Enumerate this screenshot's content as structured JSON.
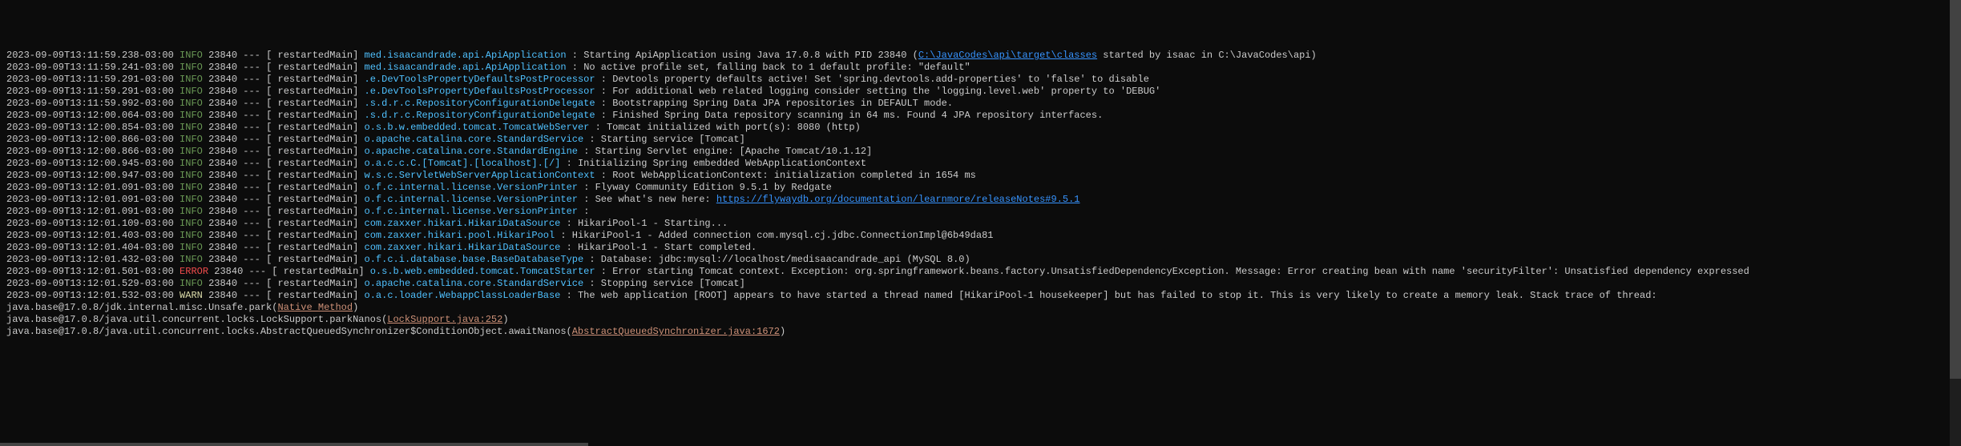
{
  "logs": [
    {
      "ts": "2023-09-09T13:11:59.238-03:00",
      "level": "INFO",
      "pid": "23840",
      "thread": "restartedMain",
      "logger": "med.isaacandrade.api.ApiApplication",
      "msg_pre": "Starting ApiApplication using Java 17.0.8 with PID 23840 (",
      "link": "C:\\JavaCodes\\api\\target\\classes",
      "msg_post": " started by isaac in C:\\JavaCodes\\api)"
    },
    {
      "ts": "2023-09-09T13:11:59.241-03:00",
      "level": "INFO",
      "pid": "23840",
      "thread": "restartedMain",
      "logger": "med.isaacandrade.api.ApiApplication",
      "msg": "No active profile set, falling back to 1 default profile: \"default\""
    },
    {
      "ts": "2023-09-09T13:11:59.291-03:00",
      "level": "INFO",
      "pid": "23840",
      "thread": "restartedMain",
      "logger": ".e.DevToolsPropertyDefaultsPostProcessor",
      "msg": "Devtools property defaults active! Set 'spring.devtools.add-properties' to 'false' to disable"
    },
    {
      "ts": "2023-09-09T13:11:59.291-03:00",
      "level": "INFO",
      "pid": "23840",
      "thread": "restartedMain",
      "logger": ".e.DevToolsPropertyDefaultsPostProcessor",
      "msg": "For additional web related logging consider setting the 'logging.level.web' property to 'DEBUG'"
    },
    {
      "ts": "2023-09-09T13:11:59.992-03:00",
      "level": "INFO",
      "pid": "23840",
      "thread": "restartedMain",
      "logger": ".s.d.r.c.RepositoryConfigurationDelegate",
      "msg": "Bootstrapping Spring Data JPA repositories in DEFAULT mode."
    },
    {
      "ts": "2023-09-09T13:12:00.064-03:00",
      "level": "INFO",
      "pid": "23840",
      "thread": "restartedMain",
      "logger": ".s.d.r.c.RepositoryConfigurationDelegate",
      "msg": "Finished Spring Data repository scanning in 64 ms. Found 4 JPA repository interfaces."
    },
    {
      "ts": "2023-09-09T13:12:00.854-03:00",
      "level": "INFO",
      "pid": "23840",
      "thread": "restartedMain",
      "logger": "o.s.b.w.embedded.tomcat.TomcatWebServer",
      "msg": "Tomcat initialized with port(s): 8080 (http)"
    },
    {
      "ts": "2023-09-09T13:12:00.866-03:00",
      "level": "INFO",
      "pid": "23840",
      "thread": "restartedMain",
      "logger": "o.apache.catalina.core.StandardService",
      "msg": "Starting service [Tomcat]"
    },
    {
      "ts": "2023-09-09T13:12:00.866-03:00",
      "level": "INFO",
      "pid": "23840",
      "thread": "restartedMain",
      "logger": "o.apache.catalina.core.StandardEngine",
      "msg": "Starting Servlet engine: [Apache Tomcat/10.1.12]"
    },
    {
      "ts": "2023-09-09T13:12:00.945-03:00",
      "level": "INFO",
      "pid": "23840",
      "thread": "restartedMain",
      "logger": "o.a.c.c.C.[Tomcat].[localhost].[/]",
      "msg": "Initializing Spring embedded WebApplicationContext"
    },
    {
      "ts": "2023-09-09T13:12:00.947-03:00",
      "level": "INFO",
      "pid": "23840",
      "thread": "restartedMain",
      "logger": "w.s.c.ServletWebServerApplicationContext",
      "msg": "Root WebApplicationContext: initialization completed in 1654 ms"
    },
    {
      "ts": "2023-09-09T13:12:01.091-03:00",
      "level": "INFO",
      "pid": "23840",
      "thread": "restartedMain",
      "logger": "o.f.c.internal.license.VersionPrinter",
      "msg": "Flyway Community Edition 9.5.1 by Redgate"
    },
    {
      "ts": "2023-09-09T13:12:01.091-03:00",
      "level": "INFO",
      "pid": "23840",
      "thread": "restartedMain",
      "logger": "o.f.c.internal.license.VersionPrinter",
      "msg_pre": "See what's new here: ",
      "link": "https://flywaydb.org/documentation/learnmore/releaseNotes#9.5.1",
      "msg_post": ""
    },
    {
      "ts": "2023-09-09T13:12:01.091-03:00",
      "level": "INFO",
      "pid": "23840",
      "thread": "restartedMain",
      "logger": "o.f.c.internal.license.VersionPrinter",
      "msg": ""
    },
    {
      "ts": "2023-09-09T13:12:01.109-03:00",
      "level": "INFO",
      "pid": "23840",
      "thread": "restartedMain",
      "logger": "com.zaxxer.hikari.HikariDataSource",
      "msg": "HikariPool-1 - Starting..."
    },
    {
      "ts": "2023-09-09T13:12:01.403-03:00",
      "level": "INFO",
      "pid": "23840",
      "thread": "restartedMain",
      "logger": "com.zaxxer.hikari.pool.HikariPool",
      "msg": "HikariPool-1 - Added connection com.mysql.cj.jdbc.ConnectionImpl@6b49da81"
    },
    {
      "ts": "2023-09-09T13:12:01.404-03:00",
      "level": "INFO",
      "pid": "23840",
      "thread": "restartedMain",
      "logger": "com.zaxxer.hikari.HikariDataSource",
      "msg": "HikariPool-1 - Start completed."
    },
    {
      "ts": "2023-09-09T13:12:01.432-03:00",
      "level": "INFO",
      "pid": "23840",
      "thread": "restartedMain",
      "logger": "o.f.c.i.database.base.BaseDatabaseType",
      "msg": "Database: jdbc:mysql://localhost/medisaacandrade_api (MySQL 8.0)"
    },
    {
      "ts": "2023-09-09T13:12:01.501-03:00",
      "level": "ERROR",
      "pid": "23840",
      "thread": "restartedMain",
      "logger": "o.s.b.web.embedded.tomcat.TomcatStarter",
      "msg": "Error starting Tomcat context. Exception: org.springframework.beans.factory.UnsatisfiedDependencyException. Message: Error creating bean with name 'securityFilter': Unsatisfied dependency expressed"
    },
    {
      "ts": "2023-09-09T13:12:01.529-03:00",
      "level": "INFO",
      "pid": "23840",
      "thread": "restartedMain",
      "logger": "o.apache.catalina.core.StandardService",
      "msg": "Stopping service [Tomcat]"
    },
    {
      "ts": "2023-09-09T13:12:01.532-03:00",
      "level": "WARN",
      "pid": "23840",
      "thread": "restartedMain",
      "logger": "o.a.c.loader.WebappClassLoaderBase",
      "msg": "The web application [ROOT] appears to have started a thread named [HikariPool-1 housekeeper] but has failed to stop it. This is very likely to create a memory leak. Stack trace of thread:"
    }
  ],
  "stack": [
    {
      "pre": " java.base@17.0.8/jdk.internal.misc.Unsafe.park(",
      "link": "Native Method",
      "post": ")"
    },
    {
      "pre": " java.base@17.0.8/java.util.concurrent.locks.LockSupport.parkNanos(",
      "link": "LockSupport.java:252",
      "post": ")"
    },
    {
      "pre": " java.base@17.0.8/java.util.concurrent.locks.AbstractQueuedSynchronizer$ConditionObject.awaitNanos(",
      "link": "AbstractQueuedSynchronizer.java:1672",
      "post": ")"
    }
  ],
  "col_widths": {
    "ts": 29,
    "level": 5,
    "pid": 5,
    "thread": 15,
    "logger": 40
  }
}
